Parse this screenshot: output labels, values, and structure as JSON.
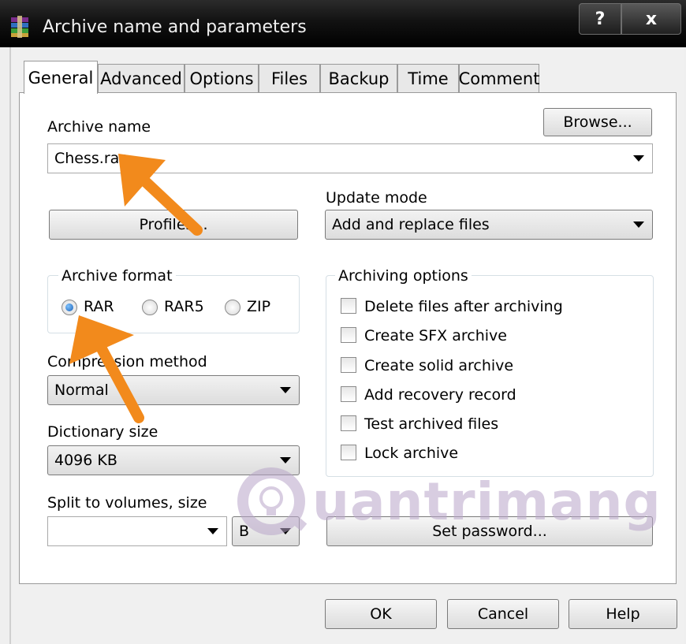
{
  "window": {
    "title": "Archive name and parameters",
    "help_label": "?",
    "close_label": "x"
  },
  "tabs": [
    {
      "label": "General",
      "active": true
    },
    {
      "label": "Advanced"
    },
    {
      "label": "Options"
    },
    {
      "label": "Files"
    },
    {
      "label": "Backup"
    },
    {
      "label": "Time"
    },
    {
      "label": "Comment"
    }
  ],
  "general": {
    "archive_name_label": "Archive name",
    "browse_label": "Browse...",
    "archive_name_value": "Chess.rar",
    "update_mode_label": "Update mode",
    "update_mode_value": "Add and replace files",
    "profiles_label": "Profiles...",
    "archive_format": {
      "title": "Archive format",
      "options": [
        "RAR",
        "RAR5",
        "ZIP"
      ],
      "selected": "RAR"
    },
    "compression_method_label": "Compression method",
    "compression_method_value": "Normal",
    "dictionary_size_label": "Dictionary size",
    "dictionary_size_value": "4096 KB",
    "split_label": "Split to volumes, size",
    "split_value": "",
    "split_unit": "B",
    "archiving_options": {
      "title": "Archiving options",
      "items": [
        "Delete files after archiving",
        "Create SFX archive",
        "Create solid archive",
        "Add recovery record",
        "Test archived files",
        "Lock archive"
      ]
    },
    "set_password_label": "Set password..."
  },
  "footer": {
    "ok_label": "OK",
    "cancel_label": "Cancel",
    "help_label": "Help"
  },
  "watermark": {
    "text": "uantrimang"
  },
  "colors": {
    "accent_arrow": "#f28a1c",
    "watermark": "#b9a6c9"
  }
}
